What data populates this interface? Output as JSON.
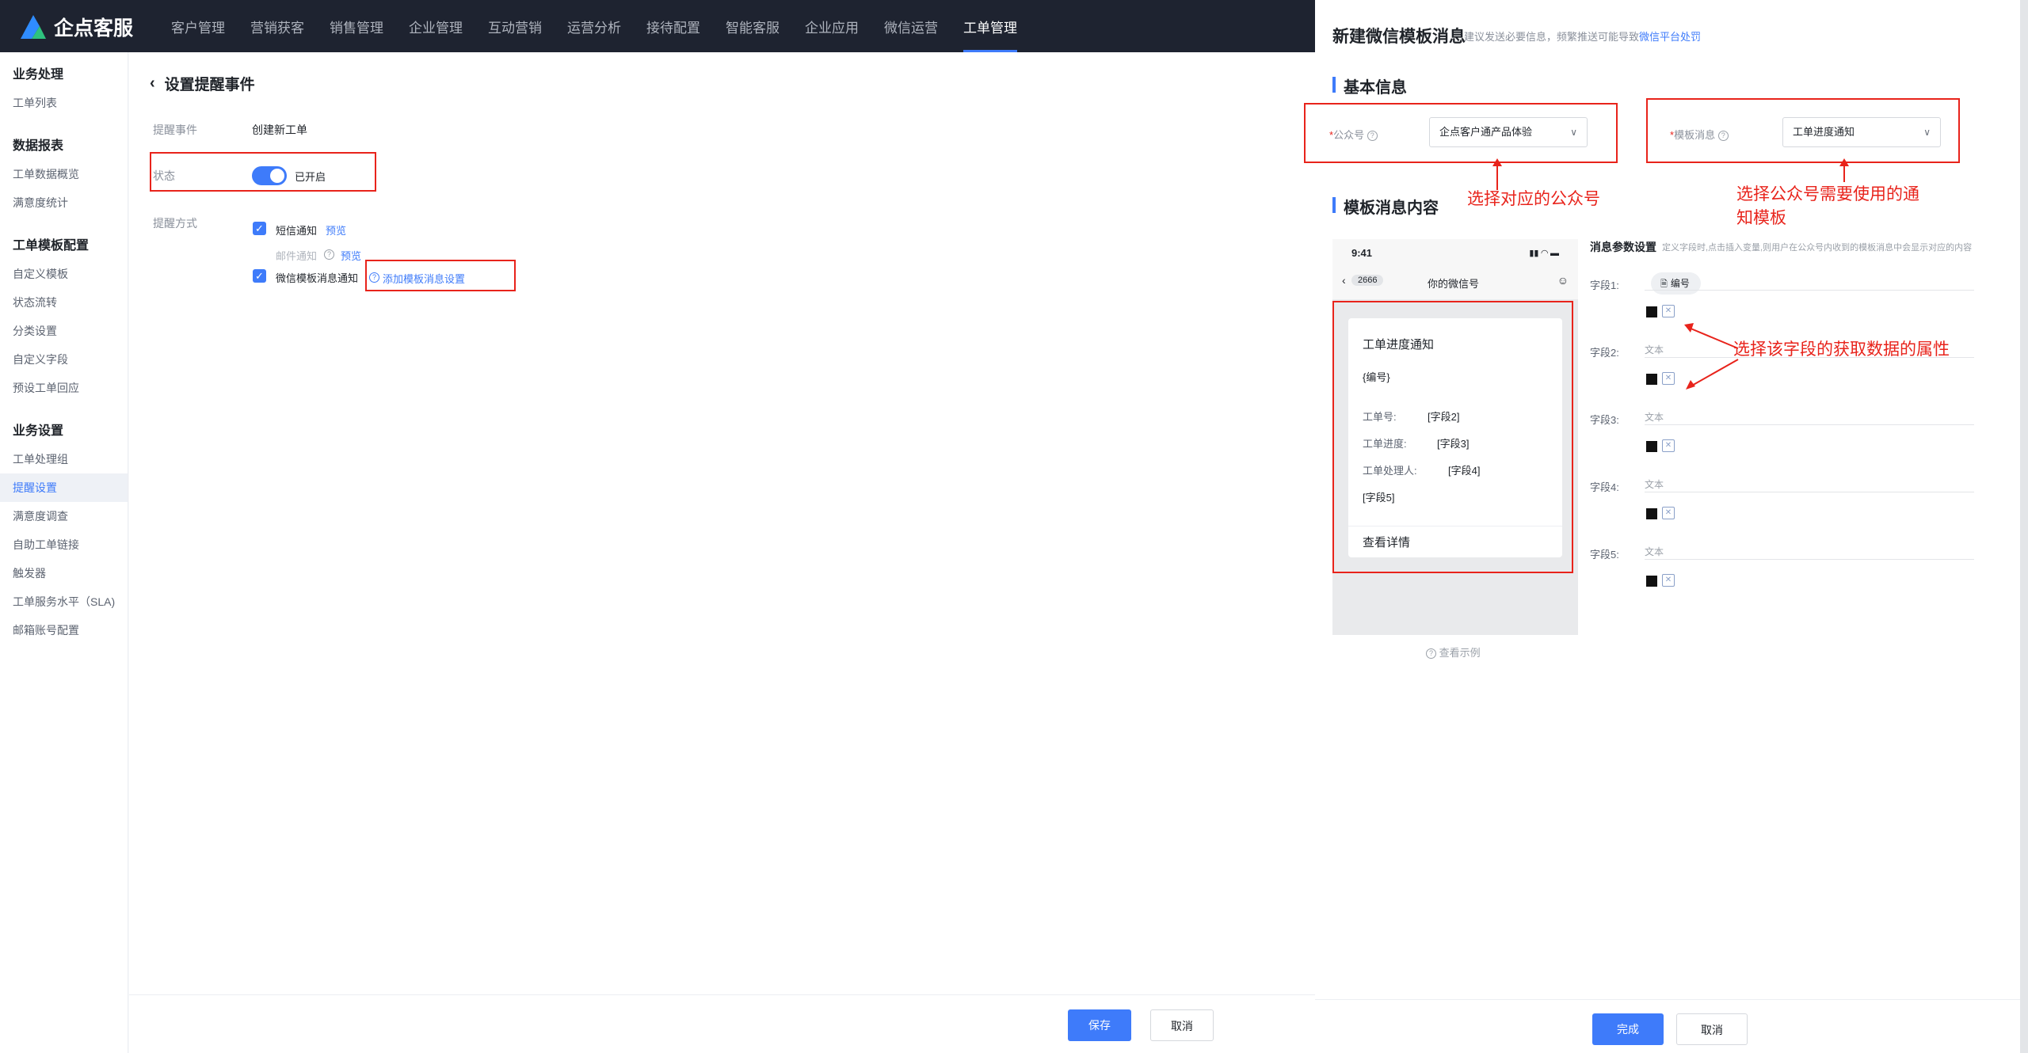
{
  "brand": {
    "name": "企点客服",
    "colors": {
      "accent": "#3e7bfa",
      "annotation": "#e8231b",
      "nav_bg": "#1e2330"
    }
  },
  "topnav": {
    "items": [
      "客户管理",
      "营销获客",
      "销售管理",
      "企业管理",
      "互动营销",
      "运营分析",
      "接待配置",
      "智能客服",
      "企业应用",
      "微信运营",
      "工单管理"
    ],
    "active": "工单管理"
  },
  "sidebar": {
    "groups": [
      {
        "title": "业务处理",
        "items": [
          "工单列表"
        ]
      },
      {
        "title": "数据报表",
        "items": [
          "工单数据概览",
          "满意度统计"
        ]
      },
      {
        "title": "工单模板配置",
        "items": [
          "自定义模板",
          "状态流转",
          "分类设置",
          "自定义字段",
          "预设工单回应"
        ]
      },
      {
        "title": "业务设置",
        "items": [
          "工单处理组",
          "提醒设置",
          "满意度调查",
          "自助工单链接",
          "触发器",
          "工单服务水平（SLA)",
          "邮箱账号配置"
        ]
      }
    ],
    "active": "提醒设置"
  },
  "page": {
    "back_icon": "chevron-left-icon",
    "title": "设置提醒事件",
    "event_label": "提醒事件",
    "event_value": "创建新工单",
    "status_label": "状态",
    "status_value": "已开启",
    "method_label": "提醒方式",
    "sms_label": "短信通知",
    "sms_preview": "预览",
    "email_label": "邮件通知",
    "email_preview": "预览",
    "wechat_label": "微信模板消息通知",
    "wechat_add": "添加模板消息设置",
    "save": "保存",
    "cancel": "取消"
  },
  "drawer": {
    "title": "新建微信模板消息",
    "hint": "建议发送必要信息，频繁推送可能导致",
    "hint_link": "微信平台处罚",
    "basic_title": "基本信息",
    "account_label": "公众号",
    "account_value": "企点客户通产品体验",
    "template_label": "模板消息",
    "template_value": "工单进度通知",
    "content_title": "模板消息内容",
    "phone": {
      "time": "9:41",
      "badge": "2666",
      "nav_title": "你的微信号",
      "card_title": "工单进度通知",
      "card_code": "{编号}",
      "rows": [
        {
          "label": "工单号:",
          "value": "[字段2]"
        },
        {
          "label": "工单进度:",
          "value": "[字段3]"
        },
        {
          "label": "工单处理人:",
          "value": "[字段4]"
        }
      ],
      "row5": "[字段5]",
      "detail": "查看详情",
      "example": "查看示例"
    },
    "params_title": "消息参数设置",
    "params_hint": "定义字段时,点击插入变量,则用户在公众号内收到的模板消息中会显示对应的内容",
    "fields": [
      {
        "label": "字段1:",
        "tag": "编号",
        "sub": ""
      },
      {
        "label": "字段2:",
        "sub": "文本"
      },
      {
        "label": "字段3:",
        "sub": "文本"
      },
      {
        "label": "字段4:",
        "sub": "文本"
      },
      {
        "label": "字段5:",
        "sub": "文本"
      }
    ],
    "done": "完成",
    "cancel": "取消"
  },
  "annotations": {
    "account": "选择对应的公众号",
    "template": "选择公众号需要使用的通知模板",
    "fields": "选择该字段的获取数据的属性"
  }
}
